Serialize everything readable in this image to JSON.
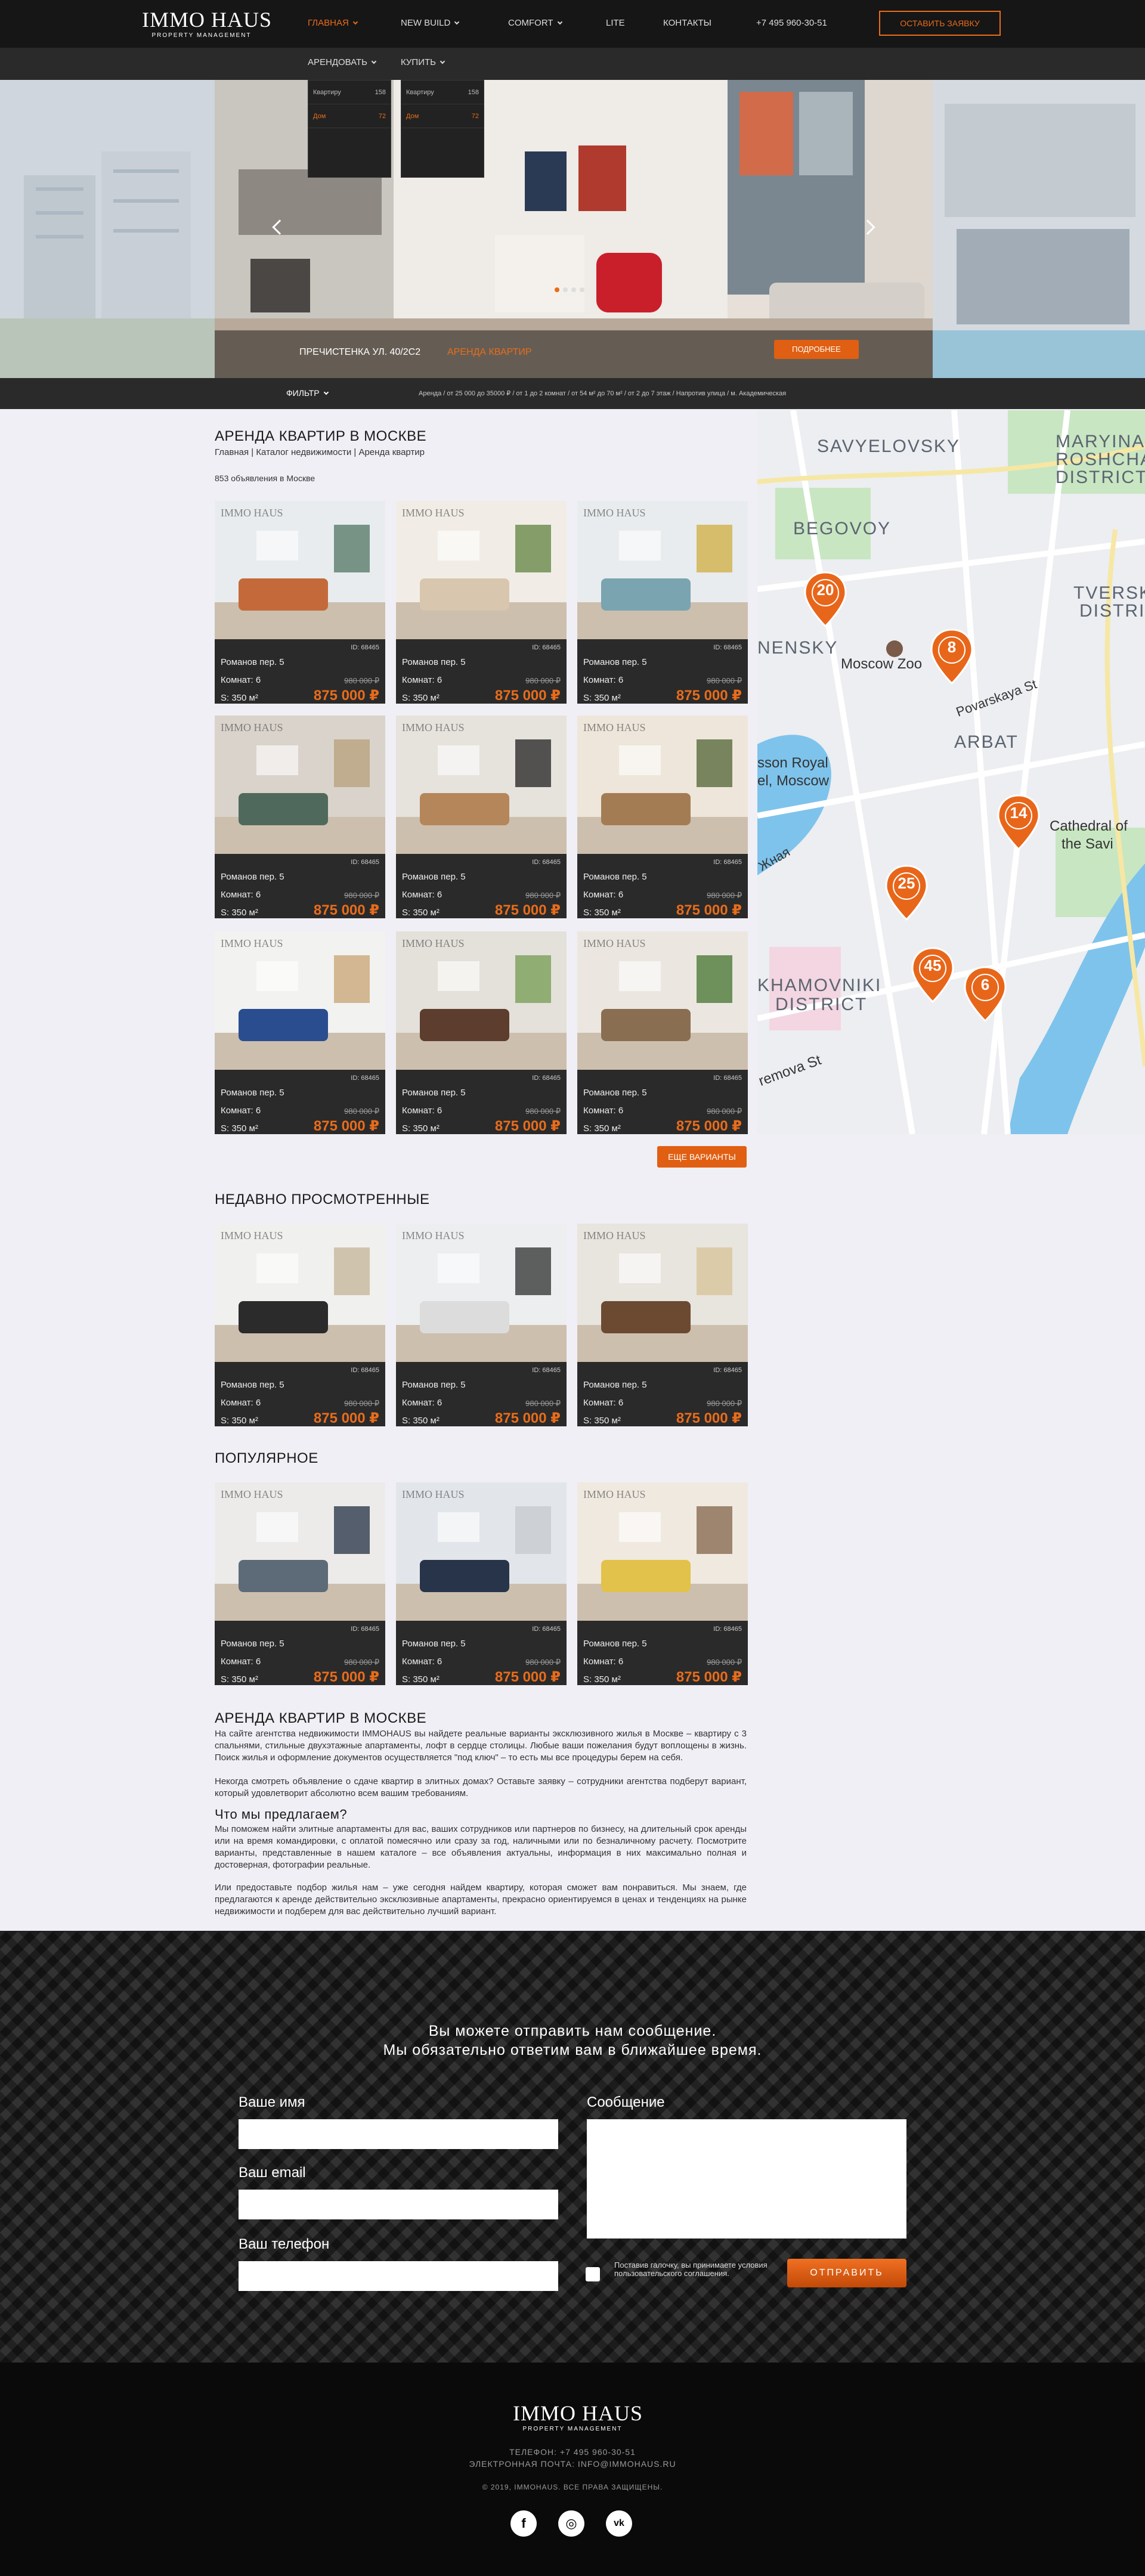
{
  "header": {
    "logo_main": "IMMO HAUS",
    "logo_sub": "PROPERTY MANAGEMENT",
    "nav": [
      "ГЛАВНАЯ",
      "NEW BUILD",
      "COMFORT",
      "LITE",
      "КОНТАКТЫ",
      "+7 495 960-30-51"
    ],
    "cta": "ОСТАВИТЬ ЗАЯВКУ",
    "subnav": [
      "АРЕНДОВАТЬ",
      "КУПИТЬ"
    ],
    "dropdown_rent": [
      {
        "label": "Квартиру",
        "count": "158"
      },
      {
        "label": "Дом",
        "count": "72"
      }
    ],
    "dropdown_buy": [
      {
        "label": "Квартиру",
        "count": "158"
      },
      {
        "label": "Дом",
        "count": "72"
      }
    ]
  },
  "hero": {
    "address": "ПРЕЧИСТЕНКА УЛ. 40/2С2",
    "type": "АРЕНДА КВАРТИР",
    "more": "ПОДРОБНЕЕ",
    "slides": 4,
    "active_slide": 1
  },
  "filter": {
    "label": "ФИЛЬТР",
    "summary": "Аренда / от 25 000 до 35000 ₽ / от 1 до 2 комнат / от 54 м² до 70 м² / от 2 до 7 этаж / Напротив улица / м. Академическая"
  },
  "listing": {
    "title": "АРЕНДА КВАРТИР В МОСКВЕ",
    "breadcrumb": "Главная | Каталог недвижимости | Аренда квартир",
    "count": "853 объявления в Москве",
    "more": "ЕЩЕ ВАРИАНТЫ"
  },
  "card": {
    "watermark": "IMMO HAUS",
    "id": "ID: 68465",
    "address": "Романов пер. 5",
    "rooms": "Комнат: 6",
    "area": "S: 350 м²",
    "old_price": "980 000 ₽",
    "price": "875 000 ₽"
  },
  "sections": {
    "recent": "НЕДАВНО ПРОСМОТРЕННЫЕ",
    "popular": "ПОПУЛЯРНОЕ"
  },
  "map": {
    "labels": [
      "SAVYELOVSKY",
      "MARYINA",
      "ROSHCHA",
      "DISTRICT",
      "BEGOVOY",
      "TVERSKO",
      "DISTRICT",
      "NENSKY",
      "Moscow Zoo",
      "Povarskaya St",
      "ARBAT",
      "sson Royal",
      "el, Moscow",
      "Cathedral of",
      "the Savi",
      "Жная",
      "KHAMOVNIKI",
      "DISTRICT",
      "remova St"
    ],
    "pins": [
      "20",
      "8",
      "14",
      "25",
      "45",
      "6"
    ]
  },
  "seo": {
    "title": "АРЕНДА КВАРТИР В МОСКВЕ",
    "p1": "На сайте агентства недвижимости IMMOHAUS вы найдете реальные варианты эксклюзивного жилья в Москве – квартиру с 3 спальнями, стильные двухэтажные апартаменты, лофт в сердце столицы. Любые ваши пожелания будут воплощены в жизнь. Поиск жилья и оформление документов осуществляется \"под ключ\" – то есть мы все процедуры берем на себя.",
    "p2": "Некогда смотреть объявление о сдаче квартир в элитных домах? Оставьте заявку – сотрудники агентства подберут вариант, который удовлетворит абсолютно всем вашим требованиям.",
    "subtitle": "Что мы предлагаем?",
    "p3": "Мы поможем найти элитные апартаменты для вас, ваших сотрудников или партнеров по бизнесу, на длительный срок аренды или на время командировки, с оплатой помесячно или сразу за год, наличными или по безналичному расчету. Посмотрите варианты, представленные в нашем каталоге – все объявления актуальны, информация в них максимально полная и достоверная, фотографии реальные.",
    "p4": "Или предоставьте подбор жилья нам – уже сегодня найдем квартиру, которая сможет вам понравиться. Мы знаем, где предлагаются к аренде действительно эксклюзивные апартаменты, прекрасно ориентируемся в ценах и тенденциях на рынке недвижимости и подберем для вас действительно лучший вариант."
  },
  "form": {
    "title1": "Вы можете отправить нам сообщение.",
    "title2": "Мы обязательно ответим вам в ближайшее время.",
    "name": "Ваше имя",
    "email": "Ваш email",
    "phone": "Ваш телефон",
    "message": "Сообщение",
    "agree": "Поставив галочку, вы принимаете условия пользовательского соглашения.",
    "send": "ОТПРАВИТЬ"
  },
  "footer": {
    "logo_main": "IMMO HAUS",
    "logo_sub": "PROPERTY MANAGEMENT",
    "phone": "ТЕЛЕФОН: +7 495 960-30-51",
    "email": "ЭЛЕКТРОННАЯ ПОЧТА: INFO@IMMOHAUS.RU",
    "copyright": "© 2019, IMMOHAUS. ВСЕ ПРАВА ЗАЩИЩЕНЫ.",
    "social": [
      "f",
      "◎",
      "vk"
    ]
  },
  "colors": {
    "accent": "#e86c1b",
    "dark": "#161616"
  }
}
